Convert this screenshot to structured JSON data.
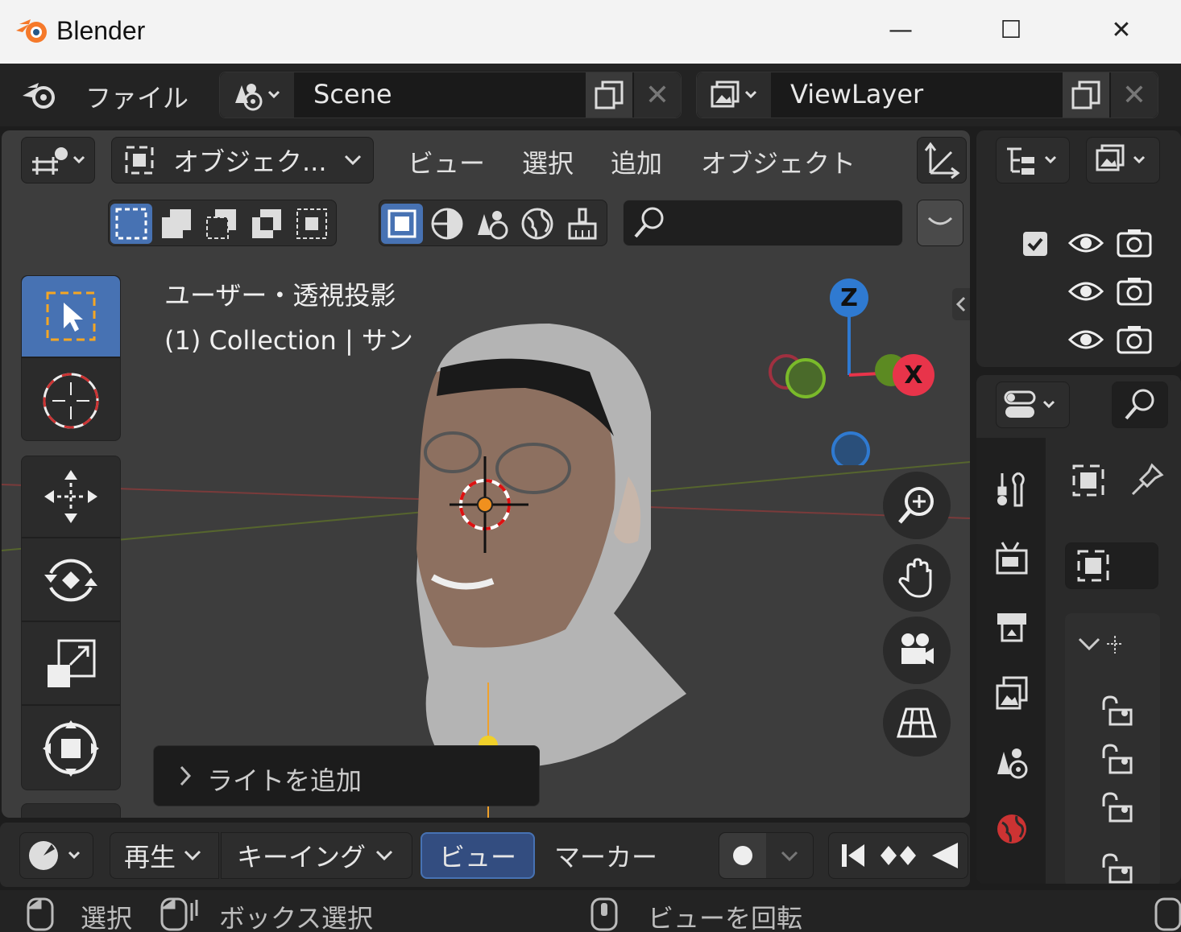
{
  "window": {
    "title": "Blender",
    "controls": [
      "—",
      "☐",
      "✕"
    ]
  },
  "topbar": {
    "file_menu": "ファイル",
    "scene": {
      "name": "Scene"
    },
    "view_layer": {
      "name": "ViewLayer"
    }
  },
  "viewport": {
    "mode": "オブジェク...",
    "menus": [
      "ビュー",
      "選択",
      "追加",
      "オブジェクト"
    ],
    "info_line1": "ユーザー・透視投影",
    "info_line2": "(1) Collection | サン",
    "gizmo": {
      "z": "Z",
      "x": "X"
    },
    "last_operation": "ライトを追加"
  },
  "timeline": {
    "playback": "再生",
    "keying": "キーイング",
    "view": "ビュー",
    "marker": "マーカー"
  },
  "statusbar": {
    "select": "選択",
    "box_select": "ボックス選択",
    "rotate_view": "ビューを回転"
  },
  "colors": {
    "accent": "#4772b3",
    "axis_x": "#e8344a",
    "axis_y": "#7aba2a",
    "axis_z": "#2f7ad1"
  }
}
